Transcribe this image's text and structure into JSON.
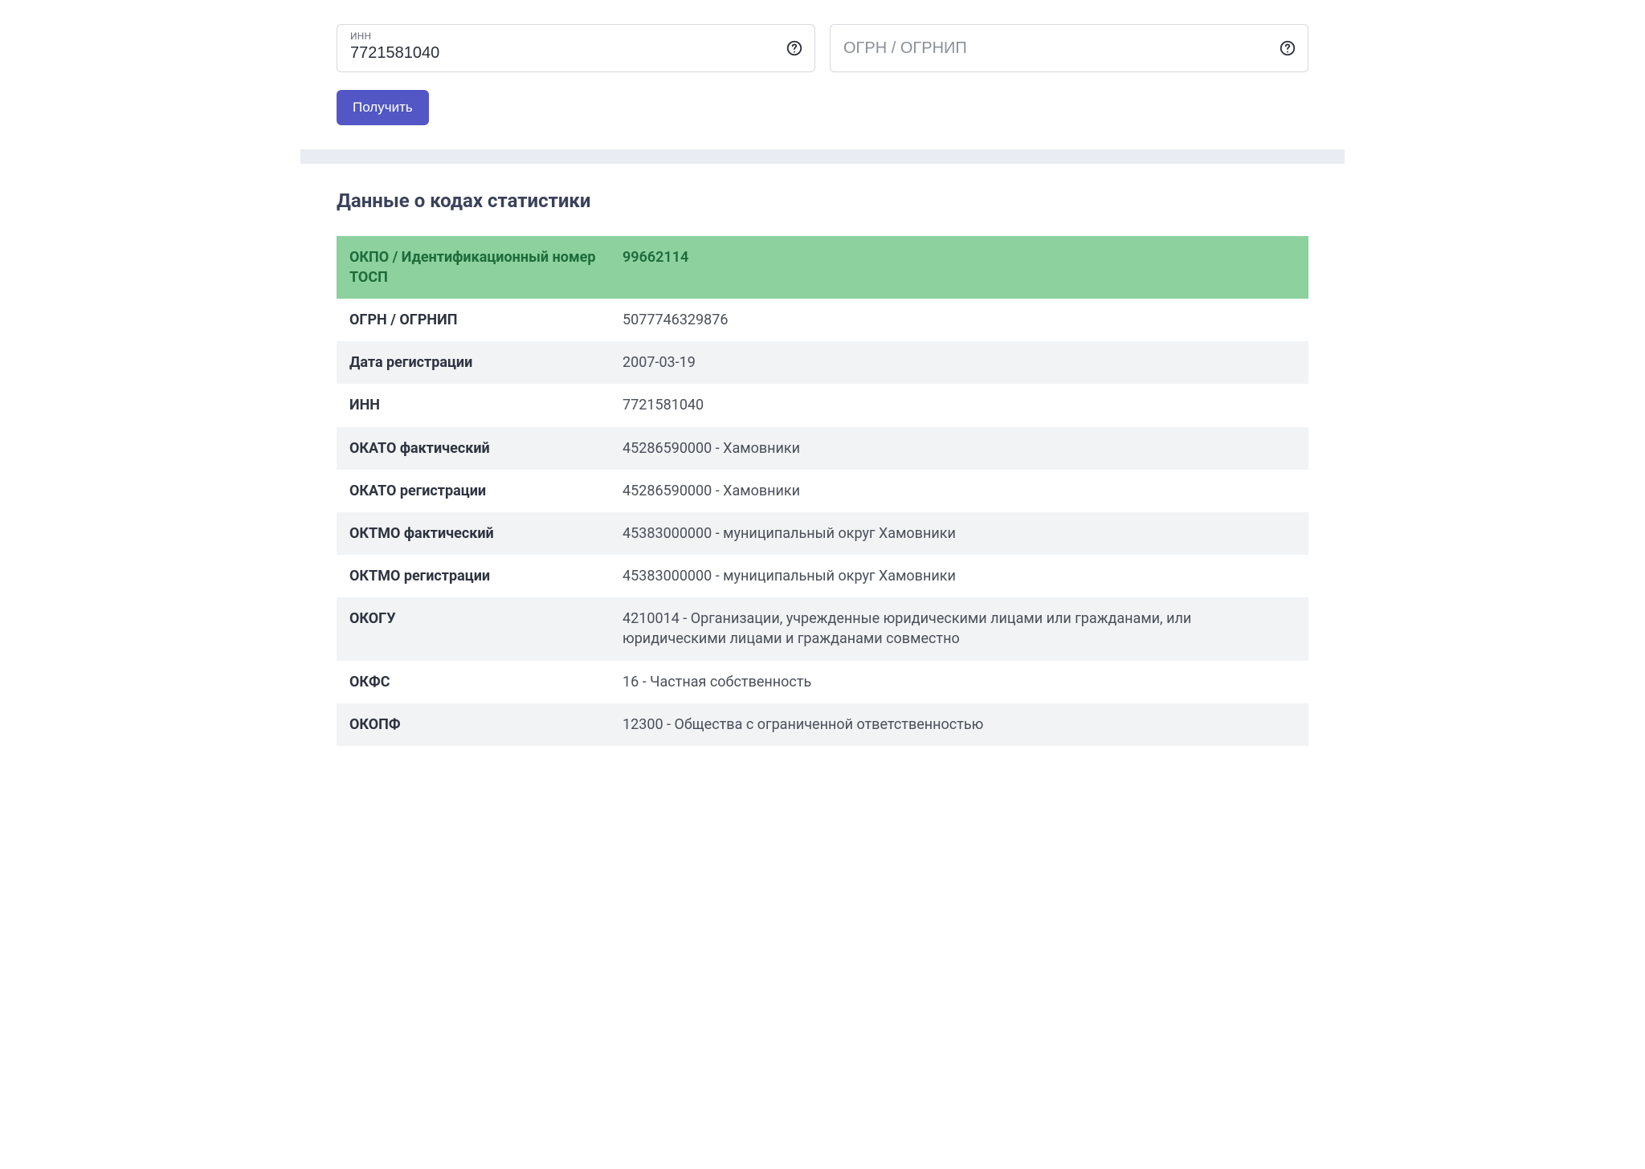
{
  "form": {
    "inn": {
      "label": "ИНН",
      "value": "7721581040"
    },
    "ogrn": {
      "placeholder": "ОГРН / ОГРНИП",
      "value": ""
    },
    "submit_label": "Получить"
  },
  "results": {
    "title": "Данные о кодах статистики",
    "rows": [
      {
        "label": "ОКПО / Идентификационный номер ТОСП",
        "value": "99662114",
        "highlight": true
      },
      {
        "label": "ОГРН / ОГРНИП",
        "value": "5077746329876"
      },
      {
        "label": "Дата регистрации",
        "value": "2007-03-19"
      },
      {
        "label": "ИНН",
        "value": "7721581040"
      },
      {
        "label": "ОКАТО фактический",
        "value": "45286590000 - Хамовники"
      },
      {
        "label": "ОКАТО регистрации",
        "value": "45286590000 - Хамовники"
      },
      {
        "label": "ОКТМО фактический",
        "value": "45383000000 - муниципальный округ Хамовники"
      },
      {
        "label": "ОКТМО регистрации",
        "value": "45383000000 - муниципальный округ Хамовники"
      },
      {
        "label": "ОКОГУ",
        "value": "4210014 - Организации, учрежденные юридическими лицами или гражданами, или юридическими лицами и гражданами совместно"
      },
      {
        "label": "ОКФС",
        "value": "16 - Частная собственность"
      },
      {
        "label": "ОКОПФ",
        "value": "12300 - Общества с ограниченной ответственностью"
      }
    ]
  }
}
